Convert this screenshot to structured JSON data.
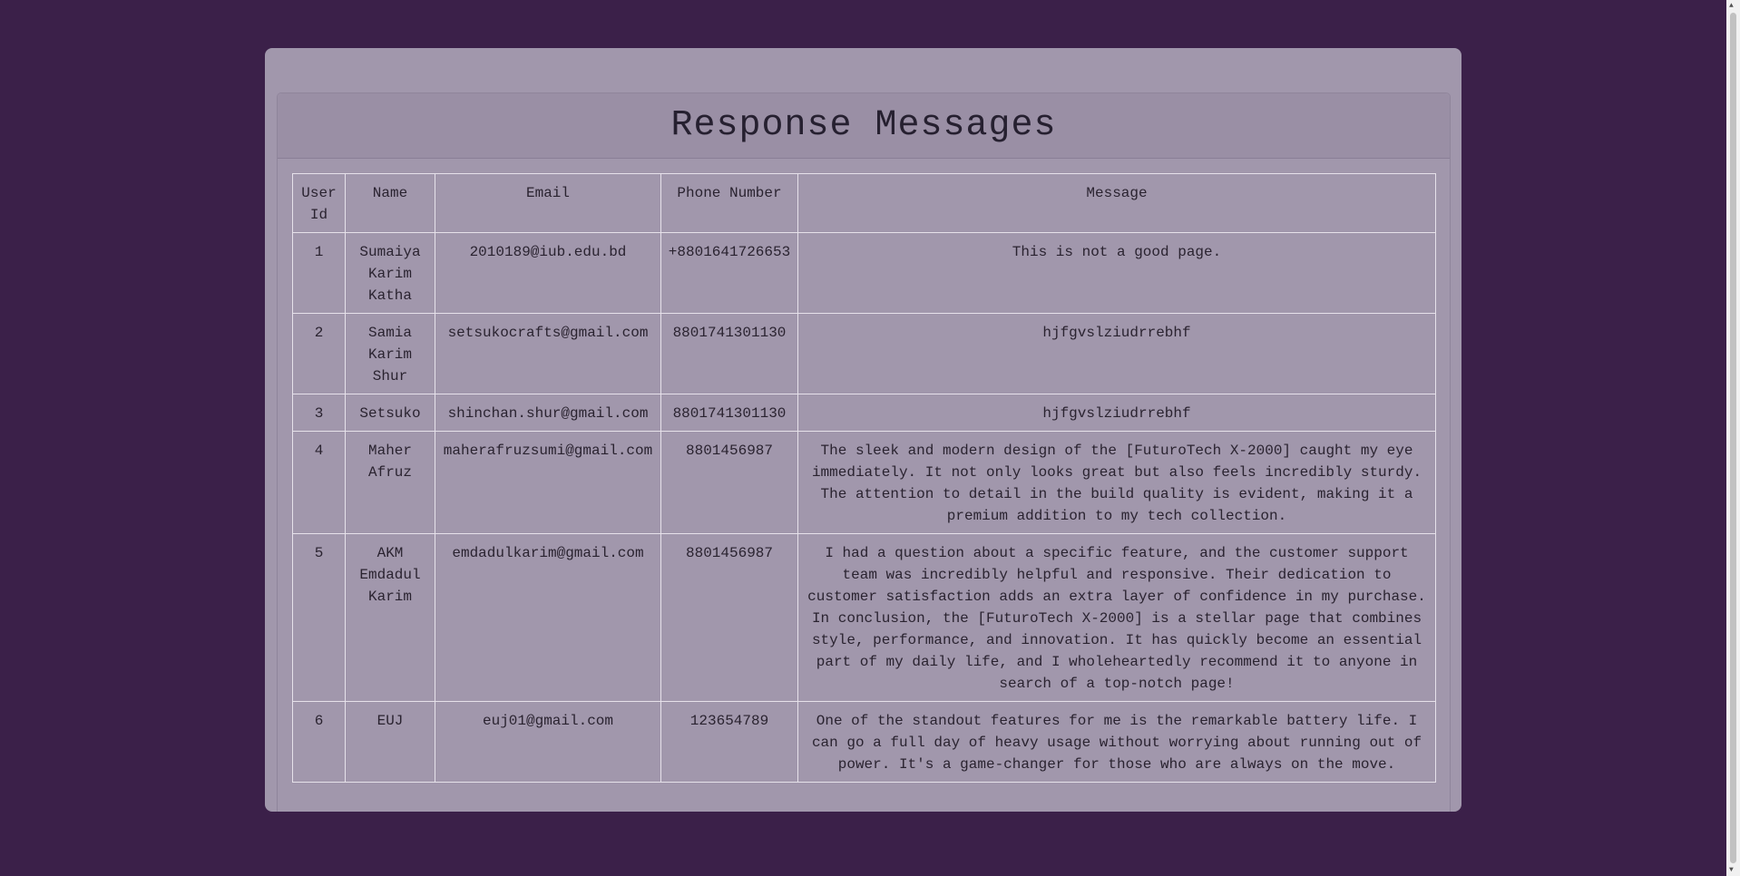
{
  "title": "Response Messages",
  "columns": [
    "User Id",
    "Name",
    "Email",
    "Phone Number",
    "Message"
  ],
  "rows": [
    {
      "id": "1",
      "name": "Sumaiya Karim Katha",
      "email": "2010189@iub.edu.bd",
      "phone": "+8801641726653",
      "message": "This is not a good page."
    },
    {
      "id": "2",
      "name": "Samia Karim Shur",
      "email": "setsukocrafts@gmail.com",
      "phone": "8801741301130",
      "message": "hjfgvslziudrrebhf"
    },
    {
      "id": "3",
      "name": "Setsuko",
      "email": "shinchan.shur@gmail.com",
      "phone": "8801741301130",
      "message": "hjfgvslziudrrebhf"
    },
    {
      "id": "4",
      "name": "Maher Afruz",
      "email": "maherafruzsumi@gmail.com",
      "phone": "8801456987",
      "message": "The sleek and modern design of the [FuturoTech X-2000] caught my eye immediately. It not only looks great but also feels incredibly sturdy. The attention to detail in the build quality is evident, making it a premium addition to my tech collection."
    },
    {
      "id": "5",
      "name": "AKM Emdadul Karim",
      "email": "emdadulkarim@gmail.com",
      "phone": "8801456987",
      "message": "I had a question about a specific feature, and the customer support team was incredibly helpful and responsive. Their dedication to customer satisfaction adds an extra layer of confidence in my purchase. In conclusion, the [FuturoTech X-2000] is a stellar page that combines style, performance, and innovation. It has quickly become an essential part of my daily life, and I wholeheartedly recommend it to anyone in search of a top-notch page!"
    },
    {
      "id": "6",
      "name": "EUJ",
      "email": "euj01@gmail.com",
      "phone": "123654789",
      "message": "One of the standout features for me is the remarkable battery life. I can go a full day of heavy usage without worrying about running out of power. It's a game-changer for those who are always on the move."
    }
  ]
}
